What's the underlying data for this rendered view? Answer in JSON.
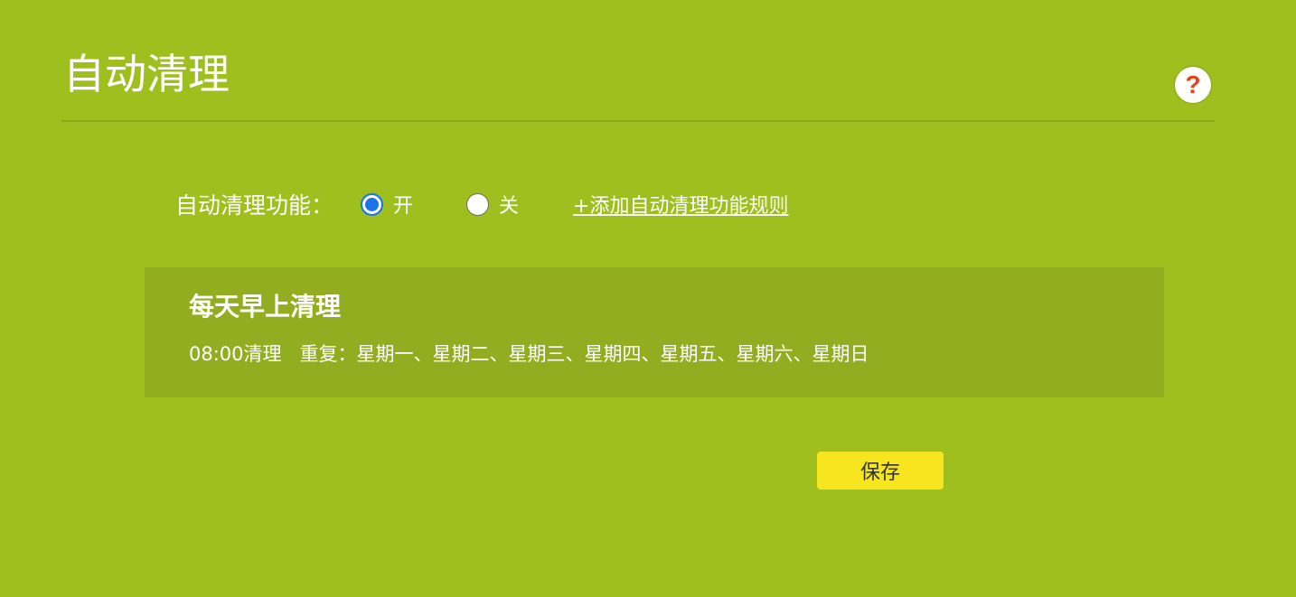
{
  "header": {
    "title": "自动清理",
    "help_icon": "question-mark-icon",
    "help_symbol": "?"
  },
  "feature": {
    "label": "自动清理功能：",
    "options": [
      {
        "label": "开",
        "selected": true
      },
      {
        "label": "关",
        "selected": false
      }
    ],
    "add_rule_link": "+添加自动清理功能规则"
  },
  "rules": [
    {
      "title": "每天早上清理",
      "time": "08:00清理",
      "repeat": "重复：星期一、星期二、星期三、星期四、星期五、星期六、星期日"
    }
  ],
  "actions": {
    "save_label": "保存"
  },
  "colors": {
    "background": "#9fbf1f",
    "card": "#92ad20",
    "save_button": "#f7e61f",
    "radio_selected": "#1a73e8",
    "help_icon": "#e8401c"
  }
}
